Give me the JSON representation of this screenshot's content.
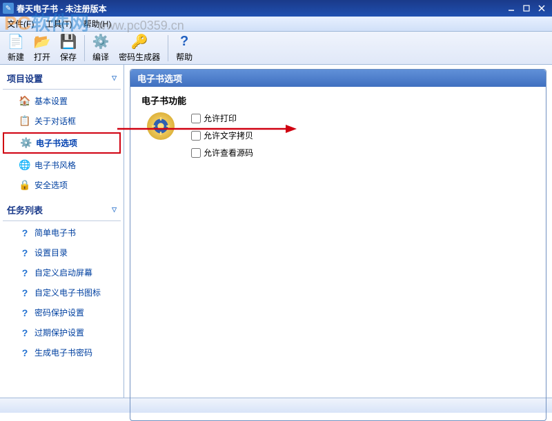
{
  "window": {
    "title": "春天电子书 - 未注册版本"
  },
  "menu": {
    "file": "文件(F)",
    "tools": "工具(T)",
    "help": "帮助(H)"
  },
  "toolbar": {
    "new": "新建",
    "open": "打开",
    "save": "保存",
    "compile": "编译",
    "pwdgen": "密码生成器",
    "help": "帮助"
  },
  "sidebar": {
    "section1": "项目设置",
    "section2": "任务列表",
    "items1": [
      {
        "label": "基本设置",
        "icon": "home"
      },
      {
        "label": "关于对话框",
        "icon": "about"
      },
      {
        "label": "电子书选项",
        "icon": "gear",
        "selected": true
      },
      {
        "label": "电子书风格",
        "icon": "globe"
      },
      {
        "label": "安全选项",
        "icon": "lock"
      }
    ],
    "items2": [
      {
        "label": "简单电子书"
      },
      {
        "label": "设置目录"
      },
      {
        "label": "自定义启动屏幕"
      },
      {
        "label": "自定义电子书图标"
      },
      {
        "label": "密码保护设置"
      },
      {
        "label": "过期保护设置"
      },
      {
        "label": "生成电子书密码"
      }
    ]
  },
  "content": {
    "panel_title": "电子书选项",
    "sub_title": "电子书功能",
    "checks": [
      "允许打印",
      "允许文字拷贝",
      "允许查看源码"
    ]
  },
  "watermark": {
    "text1": "PC",
    "text2": "软件网",
    "url": "www.pc0359.cn"
  }
}
